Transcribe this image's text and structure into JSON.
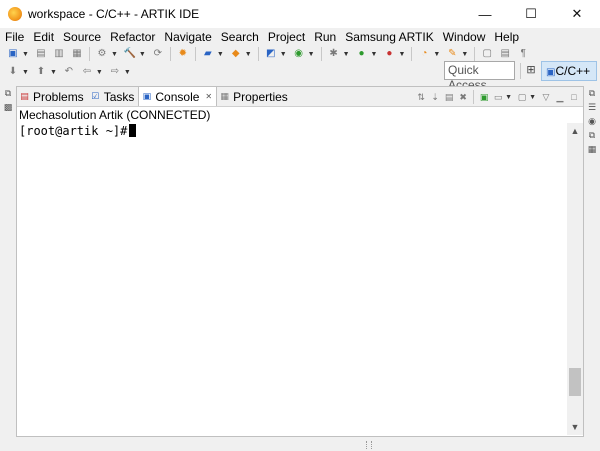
{
  "window": {
    "title": "workspace - C/C++ - ARTIK IDE",
    "minimize": "—",
    "maximize": "☐",
    "close": "✕"
  },
  "menu": [
    "File",
    "Edit",
    "Source",
    "Refactor",
    "Navigate",
    "Search",
    "Project",
    "Run",
    "Samsung ARTIK",
    "Window",
    "Help"
  ],
  "toolbar": {
    "quick_access_placeholder": "Quick Access",
    "perspective_label": "C/C++"
  },
  "view": {
    "tabs": [
      {
        "label": "Problems",
        "icon": "problems-icon",
        "active": false
      },
      {
        "label": "Tasks",
        "icon": "tasks-icon",
        "active": false
      },
      {
        "label": "Console",
        "icon": "console-icon",
        "active": true,
        "close": "✕"
      },
      {
        "label": "Properties",
        "icon": "properties-icon",
        "active": false
      }
    ],
    "console_description": "Mechasolution Artik (CONNECTED)",
    "prompt": "[root@artik ~]#",
    "scrollbar_fraction": 0.91
  }
}
